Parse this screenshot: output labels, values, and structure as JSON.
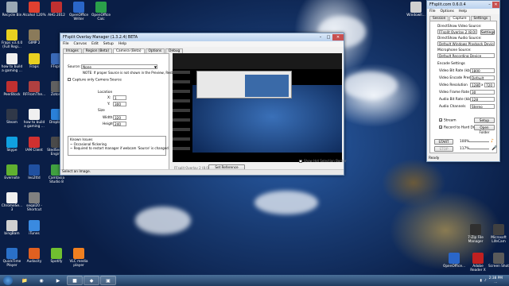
{
  "desktop": {
    "icons": [
      {
        "label": "Recycle Bin",
        "color": "#9aa8b5"
      },
      {
        "label": "Alcohol 120%",
        "color": "#e04030"
      },
      {
        "label": "AHG 2012",
        "color": "#c03030"
      },
      {
        "label": "OpenOffice Writer",
        "color": "#2a66c8"
      },
      {
        "label": "OpenOffice Calc",
        "color": "#2aa04a"
      },
      {
        "label": "Fraps v3.4.0 (Full Regi...",
        "color": "#e8d020"
      },
      {
        "label": "GIMP 2",
        "color": "#8a7a5a"
      },
      {
        "label": "how to build a gaming ...",
        "color": "#f0f0f0"
      },
      {
        "label": "Fraps",
        "color": "#e8d020"
      },
      {
        "label": "FFsplit",
        "color": "#3a6ab8"
      },
      {
        "label": "PeerBlock",
        "color": "#c03030"
      },
      {
        "label": "RFFromThe...",
        "color": "#b04040"
      },
      {
        "label": "Zotory",
        "color": "#606060"
      },
      {
        "label": "Steam",
        "color": "#303848"
      },
      {
        "label": "how to build a gaming ...",
        "color": "#f0f0f0"
      },
      {
        "label": "Dropbox",
        "color": "#2a80d8"
      },
      {
        "label": "Skype",
        "color": "#10a0e0"
      },
      {
        "label": "IAM Client",
        "color": "#d03030"
      },
      {
        "label": "StedServer Engine",
        "color": "#4a4a4a"
      },
      {
        "label": "Evernote",
        "color": "#60b030"
      },
      {
        "label": "leo2ttd",
        "color": "#2050a0"
      },
      {
        "label": "Camtasia Studio 8",
        "color": "#40a040"
      },
      {
        "label": "ChromeSe... 3",
        "color": "#f0f0f0"
      },
      {
        "label": "seqal20 - Shortcut",
        "color": "#808080"
      },
      {
        "label": "bingBam",
        "color": "#d0d0d0"
      },
      {
        "label": "iTunes",
        "color": "#3a8ae0"
      },
      {
        "label": "QuickTime Player",
        "color": "#2a70c8"
      },
      {
        "label": "Audacity",
        "color": "#e06020"
      },
      {
        "label": "Spotify",
        "color": "#70c030"
      },
      {
        "label": "VLC media player",
        "color": "#f08020"
      },
      {
        "label": "Windowll...",
        "color": "#d0d0d0"
      },
      {
        "label": "7-Zip File Manager",
        "color": "#303030"
      },
      {
        "label": "Microsoft LifeCam",
        "color": "#404040"
      },
      {
        "label": "OpenOffice...",
        "color": "#2a66c8"
      },
      {
        "label": "Adobe Reader X",
        "color": "#c02020"
      },
      {
        "label": "Screen Shot",
        "color": "#5a5a5a"
      }
    ]
  },
  "overlay_manager": {
    "title": "FFsplit Overlay Manager (1.3.2.4) BETA",
    "menu": [
      "File",
      "Canvas",
      "Edit",
      "Setup",
      "Help"
    ],
    "tabs": [
      "Images",
      "Region (Beta)",
      "Camera (Beta)",
      "Options",
      "Debug"
    ],
    "active_tab": "Camera (Beta)",
    "source_label": "Source:",
    "source_value": "None",
    "note": "NOTE: If proper Source is not shown in the Preview, Restart Manager",
    "capture_only": "Capture only Camera Source",
    "location_label": "Location",
    "x_label": "X:",
    "x_value": "1",
    "y_label": "Y:",
    "y_value": "300",
    "size_label": "Size",
    "width_label": "Width:",
    "width_value": "320",
    "height_label": "Height:",
    "height_value": "240",
    "known_issues_title": "Known Issues",
    "issue1": "~ Occasional flickering",
    "issue2": "~ Required to restart manager if webcam 'Source' is changed",
    "status": "Select an Image.",
    "preview_footer_left": "FFsplit Overlay 2 (8.0)",
    "set_reference": "Set Reference Image...",
    "show_hot_selection": "Show Hot Selection Border"
  },
  "ffsplit": {
    "title": "FFsplit.com 0.6.0.4",
    "menu": [
      "File",
      "Options",
      "Help"
    ],
    "tabs": [
      "Session",
      "Capture",
      "Settings"
    ],
    "active_tab": "Capture",
    "video_source_label": "DirectShow Video Source:",
    "video_source_value": "FFsplit Overlay 2 (8.0)",
    "settings_btn": "Settings",
    "audio_source_label": "DirectShow Audio Source:",
    "audio_source_value": "Default Windows Playback Device",
    "mic_label": "Microphone Source:",
    "mic_value": "Default Recording Device",
    "encode_settings": "Encode Settings",
    "video_bitrate_label": "Video Bit Rate (kbps)",
    "video_bitrate_value": "1800",
    "preset_label": "Video Encode Preset",
    "preset_value": "Default",
    "resolution_label": "Video Resolution",
    "res_w": "1280",
    "res_x": "x",
    "res_h": "720",
    "framerate_label": "Video Frame Rate",
    "framerate_value": "30",
    "audio_bitrate_label": "Audio Bit Rate (kbps)",
    "audio_bitrate_value": "128",
    "channels_label": "Audio Channels",
    "channels_value": "Stereo",
    "stream_label": "Stream",
    "setup_btn": "Setup",
    "record_label": "Record to Hard Drive",
    "open_folder_btn": "Open Folder",
    "start_btn": "START",
    "stop_btn": "STOP",
    "pct1": "100%",
    "pct2": "117%",
    "status": "Ready"
  },
  "taskbar": {
    "clock_time": "2:38 PM",
    "clock_date": "..."
  }
}
